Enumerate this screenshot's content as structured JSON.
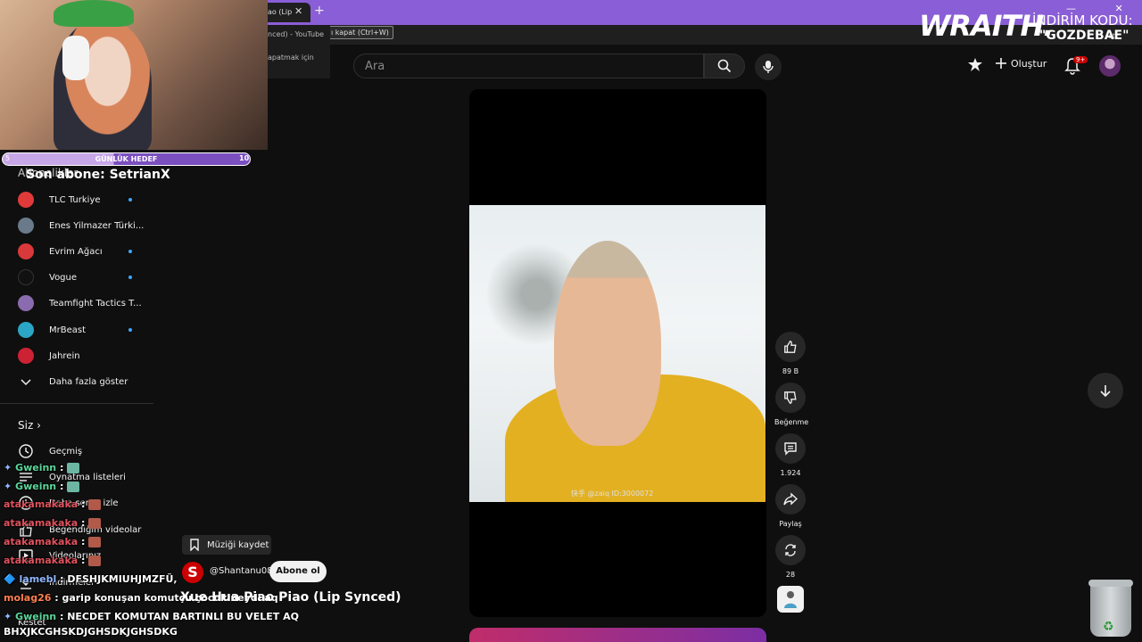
{
  "browser": {
    "tab_title": "ao (Lip",
    "tab_close": "✕",
    "new_tab": "+",
    "window_controls": "—  ✕",
    "tooltip": "ı kapat (Ctrl+W)",
    "hover_card_line1": "nced) - YouTube",
    "hover_card_line2": "apatmak için",
    "bookmark_end": "et"
  },
  "sponsor": {
    "logo": "WRAITH.",
    "promo_label": "İNDİRİM KODU:",
    "promo_code": "\"GOZDEBAE\""
  },
  "header": {
    "search_placeholder": "Ara",
    "create_label": "Oluştur",
    "notification_badge": "9+"
  },
  "stream": {
    "goal_label": "GÜNLÜK HEDEF",
    "goal_left": "5",
    "goal_right": "10",
    "last_sub": "Son abone: SetrianX",
    "subs_heading": "Abonelikler"
  },
  "sidebar": {
    "subscriptions": [
      {
        "label": "TLC Turkiye",
        "color": "#e03a3a",
        "new": true
      },
      {
        "label": "Enes Yilmazer Türki...",
        "color": "#6b7a8a",
        "new": false
      },
      {
        "label": "Evrim Ağacı",
        "color": "#d9393a",
        "new": true
      },
      {
        "label": "Vogue",
        "color": "#111111",
        "new": true
      },
      {
        "label": "Teamfight Tactics T...",
        "color": "#8b6bb0",
        "new": true
      },
      {
        "label": "MrBeast",
        "color": "#2ba6c6",
        "new": true
      },
      {
        "label": "Jahrein",
        "color": "#cc2233",
        "new": false
      }
    ],
    "show_more": "Daha fazla göster",
    "you_heading": "Siz",
    "you_items": [
      "Geçmiş",
      "Oynatma listeleri",
      "Daha sonra izle",
      "Beğendiğim videolar",
      "Videolarınız",
      "İndirmeler",
      "Kestet"
    ]
  },
  "chat": [
    {
      "user": "Gweinn",
      "user_color": "#5ad69a",
      "msg": " : "
    },
    {
      "user": "Gweinn",
      "user_color": "#5ad69a",
      "msg": " : "
    },
    {
      "user": "atakamakaka",
      "user_color": "#e0525e",
      "msg": " : "
    },
    {
      "user": "atakamakaka",
      "user_color": "#e0525e",
      "msg": " : "
    },
    {
      "user": "atakamakaka",
      "user_color": "#e0525e",
      "msg": " : "
    },
    {
      "user": "atakamakaka",
      "user_color": "#e0525e",
      "msg": " : "
    },
    {
      "user": "lamebl",
      "user_color": "#8fb8ff",
      "msg": " : DFSHJKMIUHJMZFÜ,"
    },
    {
      "user": "molag26",
      "user_color": "#ff7f50",
      "msg": " : garip konuşan komutçu çocuk neydi aq"
    },
    {
      "user": "Gweinn",
      "user_color": "#5ad69a",
      "msg": " : NECDET KOMUTAN BARTINLI BU VELET AQ"
    },
    {
      "user": "",
      "user_color": "#ffffff",
      "msg": "BHXJKCGHSKDJGHSDKJGHSDKG"
    }
  ],
  "short": {
    "save_music": "Müziği kaydet",
    "channel_logo": "S",
    "channel_name": "@Shantanu08",
    "subscribe": "Abone ol",
    "title": "Xue Hua Piao Piao (Lip Synced)",
    "watermark": "快手 @zaiq ID:3000072",
    "actions": {
      "likes": "89 B",
      "dislike": "Beğenme",
      "comments": "1.924",
      "share": "Paylaş",
      "remix": "28"
    }
  }
}
